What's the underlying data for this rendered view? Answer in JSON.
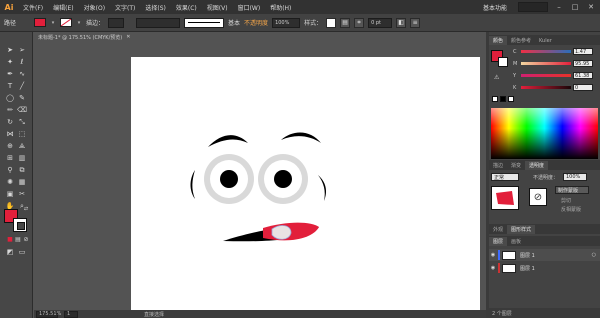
{
  "app": {
    "logo": "Ai"
  },
  "menu": {
    "items": [
      "文件(F)",
      "编辑(E)",
      "对象(O)",
      "文字(T)",
      "选择(S)",
      "效果(C)",
      "视图(V)",
      "窗口(W)",
      "帮助(H)"
    ],
    "workspace": "基本功能",
    "minimize": "–",
    "maximize": "□",
    "close": "✕"
  },
  "controlbar": {
    "path_label": "路径",
    "fill_color": "#e21f3b",
    "stroke_weight": "",
    "brush_label": "基本",
    "opacity_label": "不透明度",
    "opacity_value": "100%",
    "style_label": "样式：",
    "offset_value": "0 pt"
  },
  "document": {
    "tab_title": "未标题-1* @ 175.51% (CMYK/预览)",
    "close": "✕"
  },
  "status": {
    "zoom": "175.51%",
    "page": "1",
    "tool": "直接选择"
  },
  "colors": {
    "accent": "#e21f3b",
    "fill": "#e21f3b",
    "stroke": "#ffffff"
  },
  "panels": {
    "color_tabs": [
      "颜色",
      "颜色参考",
      "Kuler"
    ],
    "cmyk": [
      {
        "label": "C",
        "value": "1.47"
      },
      {
        "label": "M",
        "value": "95.95"
      },
      {
        "label": "Y",
        "value": "61.38"
      },
      {
        "label": "K",
        "value": "0"
      }
    ],
    "transparency_tabs": [
      "描边",
      "渐变",
      "透明度"
    ],
    "blend_mode": "正常",
    "opacity_label": "不透明度：",
    "opacity_value": "100%",
    "mask_button": "制作蒙版",
    "clip_label": "剪切",
    "invert_label": "反相蒙版",
    "appearance_tabs": [
      "外观",
      "图形样式"
    ],
    "layers_tabs": [
      "图层",
      "画板"
    ],
    "layers": [
      {
        "name": "图层 1",
        "color": "#3d6bff"
      },
      {
        "name": "图层 1",
        "color": "#cc3333"
      }
    ],
    "layers_count": "2 个图层"
  },
  "tools": {
    "icons": [
      "selection-icon",
      "direct-selection-icon",
      "magic-wand-icon",
      "lasso-icon",
      "pen-icon",
      "curvature-icon",
      "type-icon",
      "line-icon",
      "ellipse-icon",
      "paintbrush-icon",
      "pencil-icon",
      "eraser-icon",
      "rotate-icon",
      "scale-icon",
      "width-icon",
      "free-transform-icon",
      "shape-builder-icon",
      "perspective-icon",
      "mesh-icon",
      "gradient-icon",
      "eyedropper-icon",
      "blend-icon",
      "symbol-sprayer-icon",
      "graph-icon",
      "artboard-icon",
      "slice-icon",
      "hand-icon",
      "zoom-icon"
    ]
  }
}
